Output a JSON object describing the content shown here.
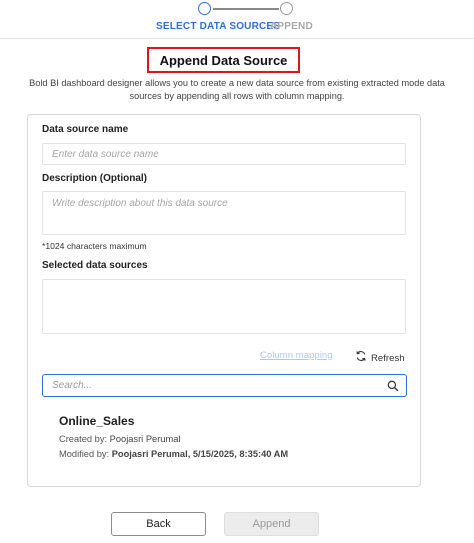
{
  "stepper": {
    "steps": [
      {
        "label": "SELECT DATA SOURCES",
        "active": true
      },
      {
        "label": "APPEND",
        "active": false
      }
    ]
  },
  "dialog": {
    "title": "Append Data Source",
    "description": "Bold BI dashboard designer allows you to create a new data source from existing extracted mode data sources by appending all rows with column mapping."
  },
  "form": {
    "name_label": "Data source name",
    "name_placeholder": "Enter data source name",
    "name_value": "",
    "description_label": "Description (Optional)",
    "description_placeholder": "Write description about this data source",
    "description_value": "",
    "char_limit_hint": "*1024 characters maximum",
    "selected_label": "Selected data sources",
    "column_mapping_label": "Column mapping",
    "refresh_label": "Refresh",
    "search_placeholder": "Search...",
    "search_value": ""
  },
  "data_sources": [
    {
      "name": "Online_Sales",
      "created_label": "Created by:",
      "created_by": "Poojasri Perumal",
      "modified_label": "Modified by:",
      "modified_by": "Poojasri Perumal, 5/15/2025, 8:35:40 AM"
    }
  ],
  "footer": {
    "back_label": "Back",
    "append_label": "Append"
  },
  "colors": {
    "accent": "#2f6fdc",
    "highlight_border": "#e0141e",
    "disabled_link": "#a9c9ef"
  },
  "icons": {
    "refresh": "refresh-icon",
    "search": "search-icon"
  }
}
